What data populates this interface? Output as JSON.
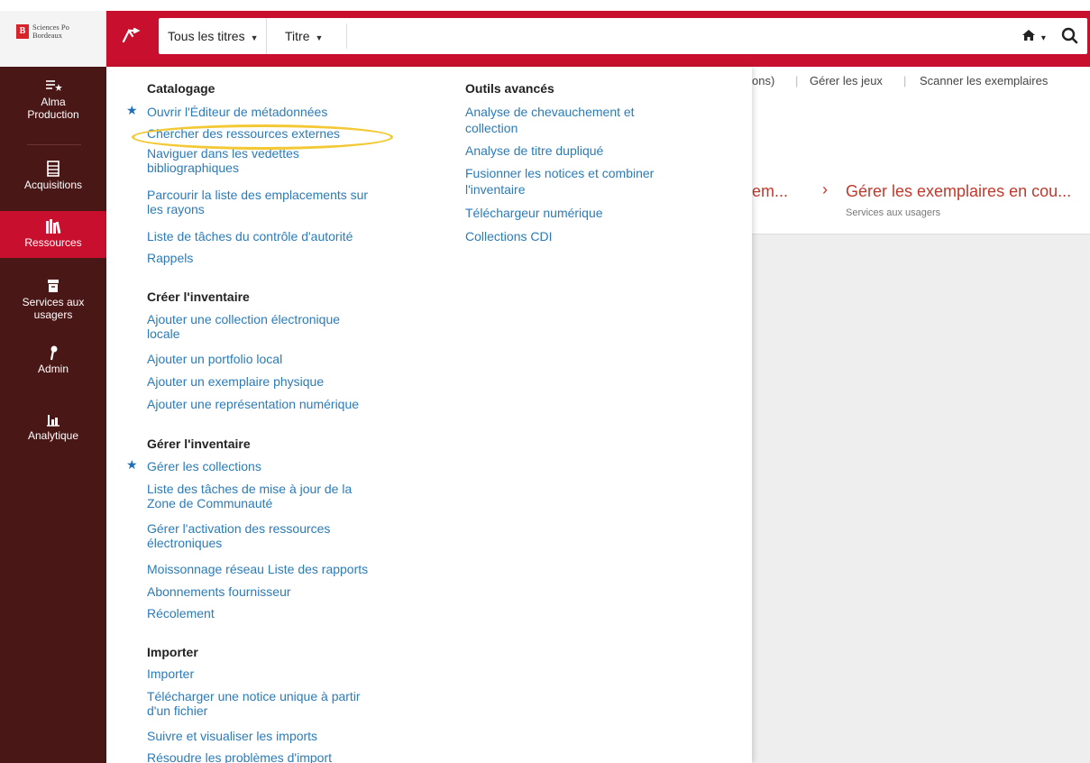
{
  "logo": {
    "line1": "Sciences Po",
    "line2": "Bordeaux"
  },
  "search": {
    "scope": "Tous les titres",
    "field": "Titre",
    "value": ""
  },
  "sidebar": {
    "items": [
      {
        "label1": "Alma",
        "label2": "Production"
      },
      {
        "label1": "Acquisitions"
      },
      {
        "label1": "Ressources"
      },
      {
        "label1": "Services aux",
        "label2": "usagers"
      },
      {
        "label1": "Admin"
      },
      {
        "label1": "Analytique"
      }
    ]
  },
  "background": {
    "actions": [
      "ons)",
      "Gérer les jeux",
      "Scanner les exemplaires"
    ],
    "card_left": "em...",
    "card_title": "Gérer les exemplaires en cou...",
    "card_sub": "Services aux usagers"
  },
  "menu": {
    "catalogage": {
      "title": "Catalogage",
      "items": [
        "Ouvrir l'Éditeur de métadonnées",
        "Chercher des ressources externes",
        "Naviguer dans les vedettes",
        "bibliographiques",
        "Parcourir la liste des emplacements sur",
        "les rayons",
        "Liste de tâches du contrôle d'autorité",
        "Rappels"
      ]
    },
    "creer": {
      "title": "Créer l'inventaire",
      "items": [
        "Ajouter une collection électronique",
        "locale",
        "Ajouter un portfolio local",
        "Ajouter un exemplaire physique",
        "Ajouter une représentation numérique"
      ]
    },
    "gerer": {
      "title": "Gérer l'inventaire",
      "items": [
        "Gérer les collections",
        "Liste des tâches de mise à jour de la",
        "Zone de Communauté",
        "Gérer l'activation des ressources",
        "électroniques",
        "Moissonnage réseau Liste des rapports",
        "Abonnements fournisseur",
        "Récolement"
      ]
    },
    "importer": {
      "title": "Importer",
      "items": [
        "Importer",
        "Télécharger une notice unique à partir",
        "d'un fichier",
        "Suivre et visualiser les imports",
        "Résoudre les problèmes d'import"
      ]
    },
    "outils": {
      "title": "Outils avancés",
      "items": [
        "Analyse de chevauchement et",
        "collection",
        "Analyse de titre dupliqué",
        "Fusionner les notices et combiner",
        "l'inventaire",
        "Téléchargeur numérique",
        "Collections CDI"
      ]
    }
  },
  "colors": {
    "brand_red": "#c8102e",
    "sidebar": "#4a1717",
    "link": "#2b7bb9",
    "highlight": "#f3c832"
  }
}
